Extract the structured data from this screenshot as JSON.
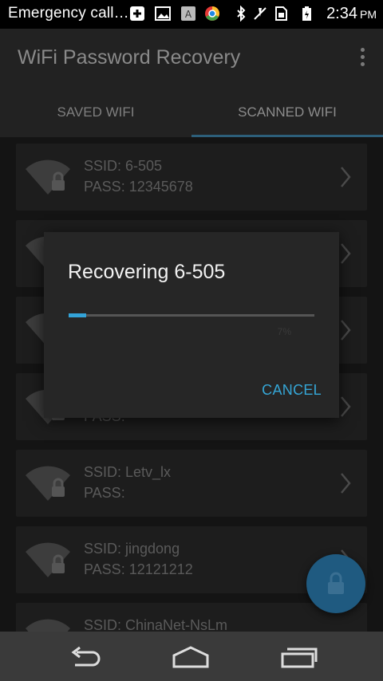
{
  "status_bar": {
    "carrier": "Emergency call…",
    "time": "2:34",
    "ampm": "PM"
  },
  "app": {
    "title": "WiFi Password Recovery"
  },
  "tabs": [
    {
      "label": "SAVED WIFI",
      "active": false
    },
    {
      "label": "SCANNED WIFI",
      "active": true
    }
  ],
  "networks": [
    {
      "ssid_line": "SSID: 6-505",
      "pass_line": "PASS: 12345678"
    },
    {
      "ssid_line": "",
      "pass_line": ""
    },
    {
      "ssid_line": "",
      "pass_line": ""
    },
    {
      "ssid_line": "",
      "pass_line": "PASS:"
    },
    {
      "ssid_line": "SSID: Letv_lx",
      "pass_line": "PASS:"
    },
    {
      "ssid_line": "SSID: jingdong",
      "pass_line": "PASS: 12121212"
    },
    {
      "ssid_line": "SSID: ChinaNet-NsLm",
      "pass_line": ""
    }
  ],
  "dialog": {
    "title": "Recovering 6-505",
    "progress_percent": 7,
    "progress_label": "7%",
    "cancel_label": "CANCEL"
  },
  "colors": {
    "accent": "#33a3d8",
    "fab": "#1f5a80"
  },
  "icons": [
    "add-box-icon",
    "image-icon",
    "a-box-icon",
    "chrome-icon",
    "bluetooth-icon",
    "mute-icon",
    "sim-icon",
    "battery-icon",
    "overflow-menu-icon",
    "wifi-lock-icon",
    "chevron-right-icon",
    "lock-icon",
    "back-icon",
    "home-icon",
    "recents-icon"
  ]
}
